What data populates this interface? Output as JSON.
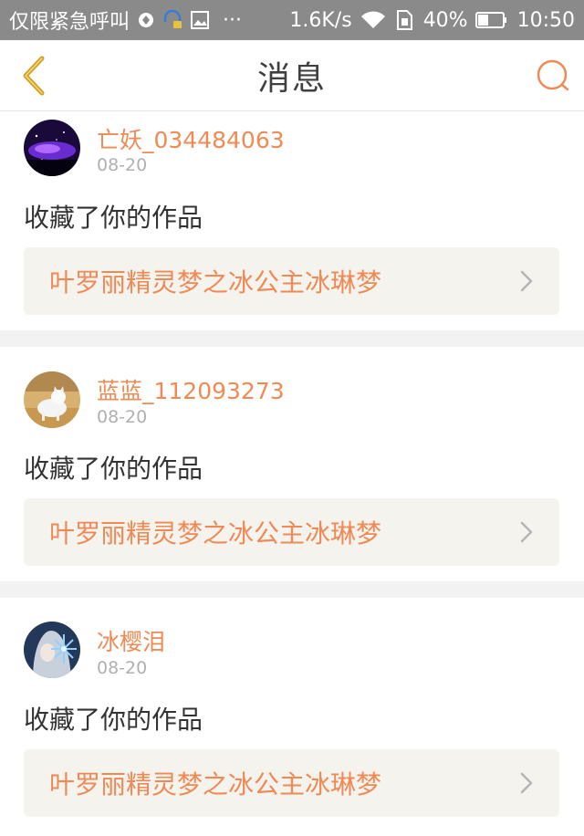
{
  "status_bar": {
    "carrier": "仅限紧急呼叫",
    "speed": "1.6K/s",
    "battery": "40%",
    "time": "10:50"
  },
  "nav": {
    "title": "消息",
    "back_icon": "chevron-left-icon",
    "search_icon": "search-icon"
  },
  "colors": {
    "accent": "#f08a55",
    "back_arrow": "#d4a020",
    "status_bar_bg": "#8a8a8a"
  },
  "messages": [
    {
      "username": "亡妖_034484063",
      "date": "08-20",
      "action": "收藏了你的作品",
      "work_title": "叶罗丽精灵梦之冰公主冰琳梦",
      "avatar": "purple-galaxy-avatar"
    },
    {
      "username": "蓝蓝_112093273",
      "date": "08-20",
      "action": "收藏了你的作品",
      "work_title": "叶罗丽精灵梦之冰公主冰琳梦",
      "avatar": "white-cat-avatar"
    },
    {
      "username": "冰樱泪",
      "date": "08-20",
      "action": "收藏了你的作品",
      "work_title": "叶罗丽精灵梦之冰公主冰琳梦",
      "avatar": "ice-girl-avatar"
    }
  ]
}
